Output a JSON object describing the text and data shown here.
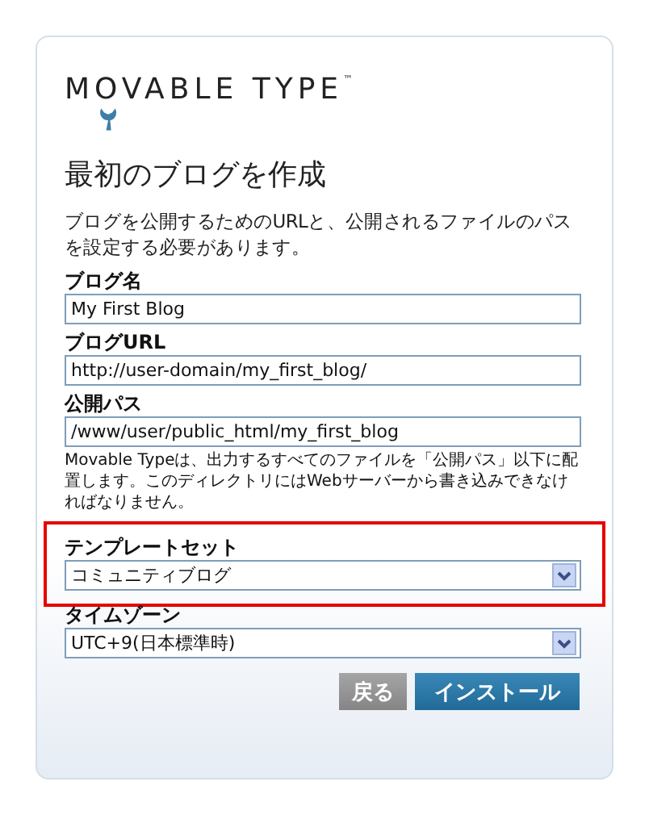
{
  "logo": {
    "text": "MOVABLE TYPE",
    "mark": "™"
  },
  "title": "最初のブログを作成",
  "intro": "ブログを公開するためのURLと、公開されるファイルのパスを設定する必要があります。",
  "fields": [
    {
      "kind": "text",
      "label": "ブログ名",
      "value": "My First Blog",
      "highlighted": false
    },
    {
      "kind": "text",
      "label": "ブログURL",
      "value": "http://user-domain/my_first_blog/",
      "highlighted": false
    },
    {
      "kind": "text",
      "label": "公開パス",
      "value": "/www/user/public_html/my_first_blog",
      "hint": "Movable Typeは、出力するすべてのファイルを「公開パス」以下に配置します。このディレクトリにはWebサーバーから書き込みできなければなりません。",
      "highlighted": false
    },
    {
      "kind": "select",
      "label": "テンプレートセット",
      "value": "コミュニティブログ",
      "highlighted": true
    },
    {
      "kind": "select",
      "label": "タイムゾーン",
      "value": "UTC+9(日本標準時)",
      "highlighted": false
    }
  ],
  "buttons": [
    {
      "label": "戻る",
      "kind": "secondary"
    },
    {
      "label": "インストール",
      "kind": "primary"
    }
  ]
}
